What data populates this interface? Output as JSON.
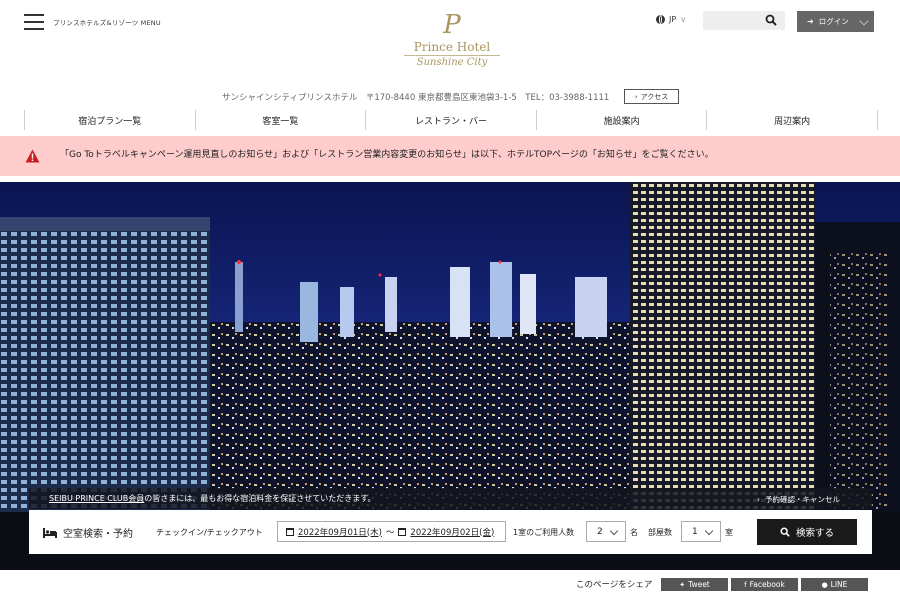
{
  "header": {
    "menu_label": "プリンスホテルズ&リゾーツ MENU",
    "logo_mark": "P",
    "logo_title": "Prince Hotel",
    "logo_subtitle": "Sunshine City",
    "language": "JP",
    "search_placeholder": "",
    "login_label": "ログイン"
  },
  "address": {
    "text": "サンシャインシティプリンスホテル　〒170-8440 東京都豊島区東池袋3-1-5　TEL：03-3988-1111",
    "access_label": "アクセス"
  },
  "nav": {
    "items": [
      {
        "label": "宿泊プラン一覧"
      },
      {
        "label": "客室一覧"
      },
      {
        "label": "レストラン・バー"
      },
      {
        "label": "施設案内"
      },
      {
        "label": "周辺案内"
      }
    ]
  },
  "notice": {
    "text": "「Go Toトラベルキャンペーン運用見直しのお知らせ」および「レストラン営業内容変更のお知らせ」は以下、ホテルTOPページの「お知らせ」をご覧ください。"
  },
  "member_bar": {
    "link_text": "SEIBU PRINCE CLUB会員",
    "text": "の皆さまには、最もお得な宿泊料金を保証させていただきます。",
    "reservation_link": "予約確認・キャンセル"
  },
  "booking": {
    "title": "空室検索・予約",
    "checkin_label": "チェックイン/チェックアウト",
    "checkin_date": "2022年09月01日(木)",
    "separator": "〜",
    "checkout_date": "2022年09月02日(金)",
    "guests_label": "1室のご利用人数",
    "guests_value": "2",
    "guests_unit": "名",
    "rooms_label": "部屋数",
    "rooms_value": "1",
    "rooms_unit": "室",
    "search_button": "検索する"
  },
  "share": {
    "label": "このページをシェア",
    "buttons": [
      {
        "label": "Tweet"
      },
      {
        "label": "Facebook"
      },
      {
        "label": "LINE"
      }
    ]
  },
  "colors": {
    "gold": "#a8955f",
    "notice_bg": "#ffcccc",
    "alert_red": "#cc1f1f",
    "dark": "#1a1a1a"
  }
}
